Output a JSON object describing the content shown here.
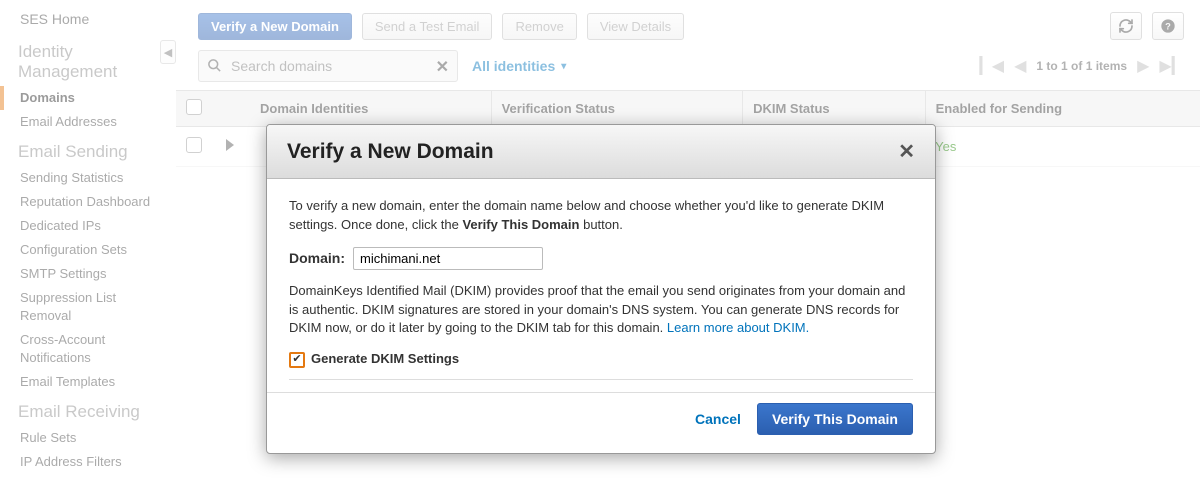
{
  "sidebar": {
    "home": "SES Home",
    "groups": [
      {
        "title": "Identity Management",
        "items": [
          "Domains",
          "Email Addresses"
        ],
        "active_index": 0
      },
      {
        "title": "Email Sending",
        "items": [
          "Sending Statistics",
          "Reputation Dashboard",
          "Dedicated IPs",
          "Configuration Sets",
          "SMTP Settings",
          "Suppression List Removal",
          "Cross-Account Notifications",
          "Email Templates"
        ]
      },
      {
        "title": "Email Receiving",
        "items": [
          "Rule Sets",
          "IP Address Filters"
        ]
      }
    ]
  },
  "toolbar": {
    "verify": "Verify a New Domain",
    "send_test": "Send a Test Email",
    "remove": "Remove",
    "view_details": "View Details"
  },
  "filter": {
    "search_placeholder": "Search domains",
    "all_identities": "All identities",
    "pager_text": "1 to 1 of 1 items"
  },
  "table": {
    "headers": {
      "domain": "Domain Identities",
      "verification": "Verification Status",
      "dkim": "DKIM Status",
      "enabled": "Enabled for Sending"
    },
    "rows": [
      {
        "domain": "",
        "verification": "",
        "dkim": "",
        "enabled": "Yes"
      }
    ]
  },
  "modal": {
    "title": "Verify a New Domain",
    "intro_a": "To verify a new domain, enter the domain name below and choose whether you'd like to generate DKIM settings. Once done, click the ",
    "intro_strong": "Verify This Domain",
    "intro_b": " button.",
    "domain_label": "Domain:",
    "domain_value": "michimani.net",
    "dkim_text": "DomainKeys Identified Mail (DKIM) provides proof that the email you send originates from your domain and is authentic. DKIM signatures are stored in your domain's DNS system. You can generate DNS records for DKIM now, or do it later by going to the DKIM tab for this domain. ",
    "learn_more": "Learn more about DKIM.",
    "dkim_checkbox_label": "Generate DKIM Settings",
    "cancel": "Cancel",
    "verify": "Verify This Domain"
  }
}
